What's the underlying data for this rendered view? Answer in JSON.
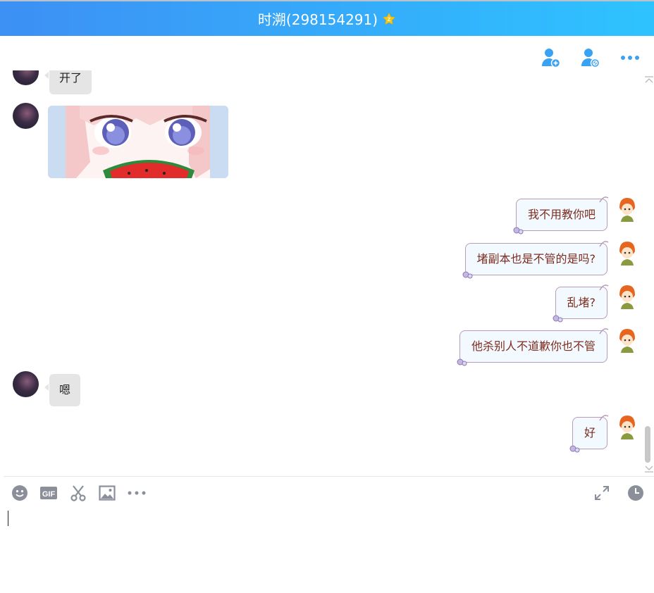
{
  "window": {
    "title": "时溯(298154291)"
  },
  "header_actions": {
    "add_friend_icon": "add-user-icon",
    "block_icon": "block-user-icon",
    "more_icon": "more-icon"
  },
  "messages": [
    {
      "side": "left",
      "kind": "text",
      "text": "开了"
    },
    {
      "side": "left",
      "kind": "sticker"
    },
    {
      "side": "right",
      "kind": "text",
      "text": "我不用教你吧"
    },
    {
      "side": "right",
      "kind": "text",
      "text": "堵副本也是不管的是吗?"
    },
    {
      "side": "right",
      "kind": "text",
      "text": "乱堵?"
    },
    {
      "side": "right",
      "kind": "text",
      "text": "他杀别人不道歉你也不管"
    },
    {
      "side": "left",
      "kind": "text",
      "text": "嗯"
    },
    {
      "side": "right",
      "kind": "text",
      "text": "好"
    }
  ],
  "input_toolbar": {
    "left_icons": [
      "emoji-icon",
      "gif-icon",
      "scissors-icon",
      "image-icon",
      "more-icon"
    ],
    "right_icons": [
      "expand-icon",
      "history-clock-icon"
    ]
  },
  "input": {
    "value": ""
  },
  "colors": {
    "titlebar_start": "#3d90f4",
    "titlebar_end": "#2ec3ff",
    "accent_icon": "#3aa2f2",
    "my_bubble_text": "#7d2c1e",
    "their_bubble_bg": "#e5e5e5"
  }
}
